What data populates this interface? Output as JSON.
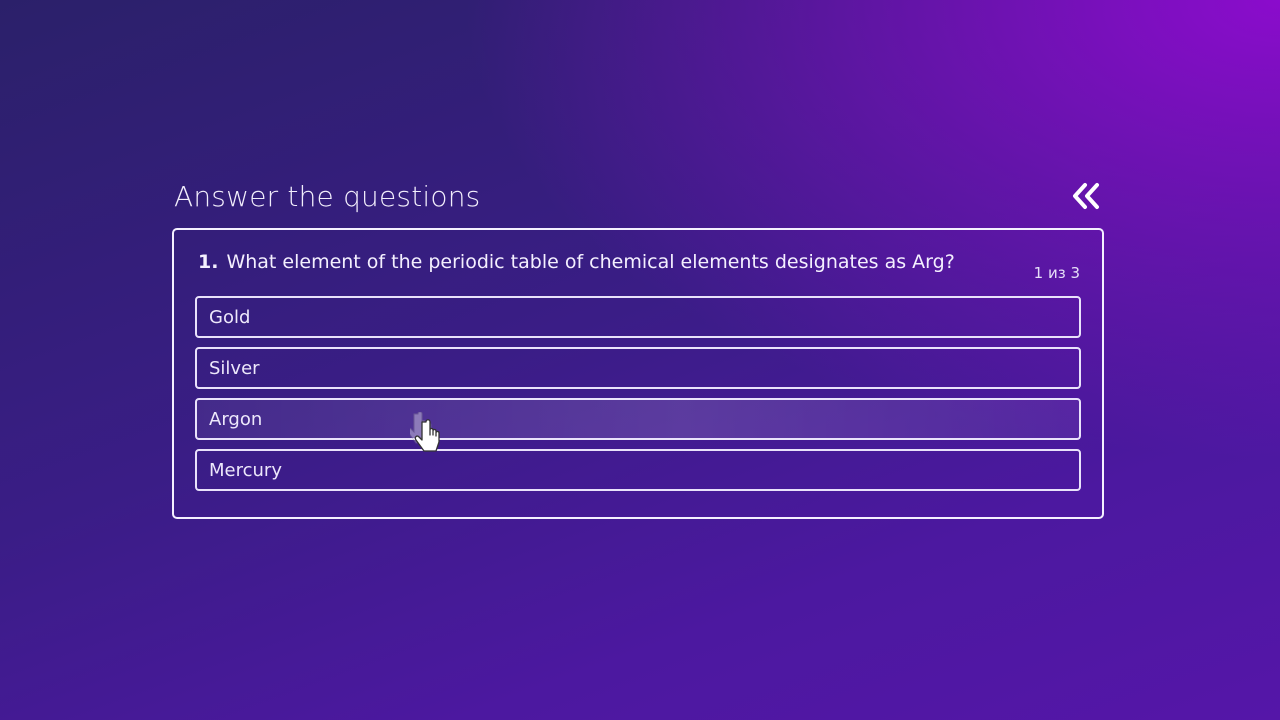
{
  "quiz": {
    "title": "Answer the questions",
    "collapse_icon": "double-chevron-left-icon",
    "question": {
      "number": "1.",
      "text": "What element of the periodic table of chemical elements designates as Arg?",
      "counter": "1 из 3"
    },
    "options": [
      {
        "label": "Gold"
      },
      {
        "label": "Silver"
      },
      {
        "label": "Argon"
      },
      {
        "label": "Mercury"
      }
    ]
  },
  "cursor_icon": "hand-pointer-icon",
  "colors": {
    "background_start": "#2b206a",
    "background_end": "#8b0ccc",
    "border": "#f4f0ff"
  }
}
